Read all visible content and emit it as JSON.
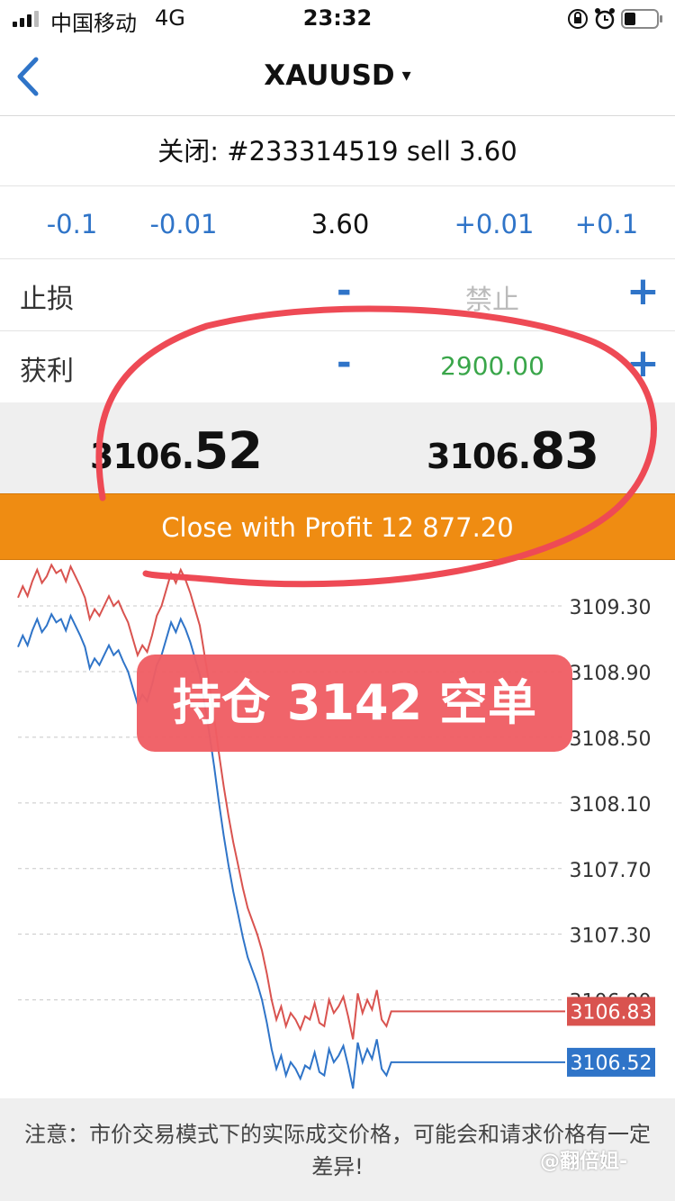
{
  "status_bar": {
    "carrier": "中国移动",
    "network": "4G",
    "time": "23:32"
  },
  "nav": {
    "symbol": "XAUUSD",
    "caret": "▾"
  },
  "order": {
    "close_title": "关闭: #233314519 sell 3.60",
    "volume_steps": [
      "-0.1",
      "-0.01",
      "+0.01",
      "+0.1"
    ],
    "volume": "3.60"
  },
  "stop_loss": {
    "label": "止损",
    "minus": "-",
    "value": "禁止",
    "plus": "+"
  },
  "take_profit": {
    "label": "获利",
    "minus": "-",
    "value": "2900.00",
    "plus": "+",
    "color": "#3aa64a"
  },
  "quotes": {
    "bid_small": "3106.",
    "bid_big": "52",
    "ask_small": "3106.",
    "ask_big": "83"
  },
  "close_button": {
    "label": "Close with Profit 12 877.20",
    "color": "#ef8c12"
  },
  "annotation": {
    "badge": "持仓 3142 空单",
    "badge_color": "#f05e64",
    "circle_color": "#ee4a55"
  },
  "chart_data": {
    "type": "line",
    "y_tick_labels": [
      "3109.30",
      "3108.90",
      "3108.50",
      "3108.10",
      "3107.70",
      "3107.30",
      "3106.90"
    ],
    "ylim": [
      3106.3,
      3109.58
    ],
    "grid": true,
    "series": [
      {
        "color": "#d9534f",
        "last_label": "3106.83",
        "values": [
          3109.35,
          3109.42,
          3109.36,
          3109.45,
          3109.52,
          3109.44,
          3109.48,
          3109.55,
          3109.5,
          3109.52,
          3109.45,
          3109.54,
          3109.48,
          3109.42,
          3109.35,
          3109.22,
          3109.28,
          3109.24,
          3109.3,
          3109.36,
          3109.3,
          3109.33,
          3109.26,
          3109.2,
          3109.1,
          3109.0,
          3109.06,
          3109.02,
          3109.12,
          3109.24,
          3109.3,
          3109.4,
          3109.5,
          3109.44,
          3109.52,
          3109.46,
          3109.38,
          3109.28,
          3109.18,
          3109.0,
          3108.82,
          3108.62,
          3108.4,
          3108.2,
          3108.02,
          3107.86,
          3107.72,
          3107.58,
          3107.46,
          3107.38,
          3107.3,
          3107.2,
          3107.06,
          3106.9,
          3106.78,
          3106.86,
          3106.74,
          3106.82,
          3106.78,
          3106.72,
          3106.8,
          3106.78,
          3106.88,
          3106.76,
          3106.74,
          3106.9,
          3106.82,
          3106.86,
          3106.92,
          3106.8,
          3106.66,
          3106.94,
          3106.82,
          3106.9,
          3106.84,
          3106.96,
          3106.78,
          3106.74,
          3106.83,
          3106.83
        ]
      },
      {
        "color": "#2f74c8",
        "last_label": "3106.52",
        "values": [
          3109.05,
          3109.12,
          3109.06,
          3109.15,
          3109.22,
          3109.14,
          3109.18,
          3109.25,
          3109.2,
          3109.22,
          3109.15,
          3109.24,
          3109.18,
          3109.12,
          3109.05,
          3108.92,
          3108.98,
          3108.94,
          3109.0,
          3109.06,
          3109.0,
          3109.03,
          3108.96,
          3108.9,
          3108.8,
          3108.7,
          3108.76,
          3108.72,
          3108.82,
          3108.94,
          3109.0,
          3109.1,
          3109.2,
          3109.14,
          3109.22,
          3109.16,
          3109.08,
          3108.98,
          3108.88,
          3108.7,
          3108.52,
          3108.32,
          3108.1,
          3107.9,
          3107.72,
          3107.56,
          3107.42,
          3107.28,
          3107.16,
          3107.08,
          3107.0,
          3106.9,
          3106.76,
          3106.6,
          3106.48,
          3106.56,
          3106.44,
          3106.52,
          3106.48,
          3106.42,
          3106.5,
          3106.48,
          3106.58,
          3106.46,
          3106.44,
          3106.6,
          3106.52,
          3106.56,
          3106.62,
          3106.5,
          3106.36,
          3106.64,
          3106.52,
          3106.6,
          3106.54,
          3106.66,
          3106.48,
          3106.44,
          3106.52,
          3106.52
        ]
      }
    ]
  },
  "footer": {
    "note": "注意：市价交易模式下的实际成交价格，可能会和请求价格有一定差异!",
    "watermark": "@翻倍姐-"
  }
}
